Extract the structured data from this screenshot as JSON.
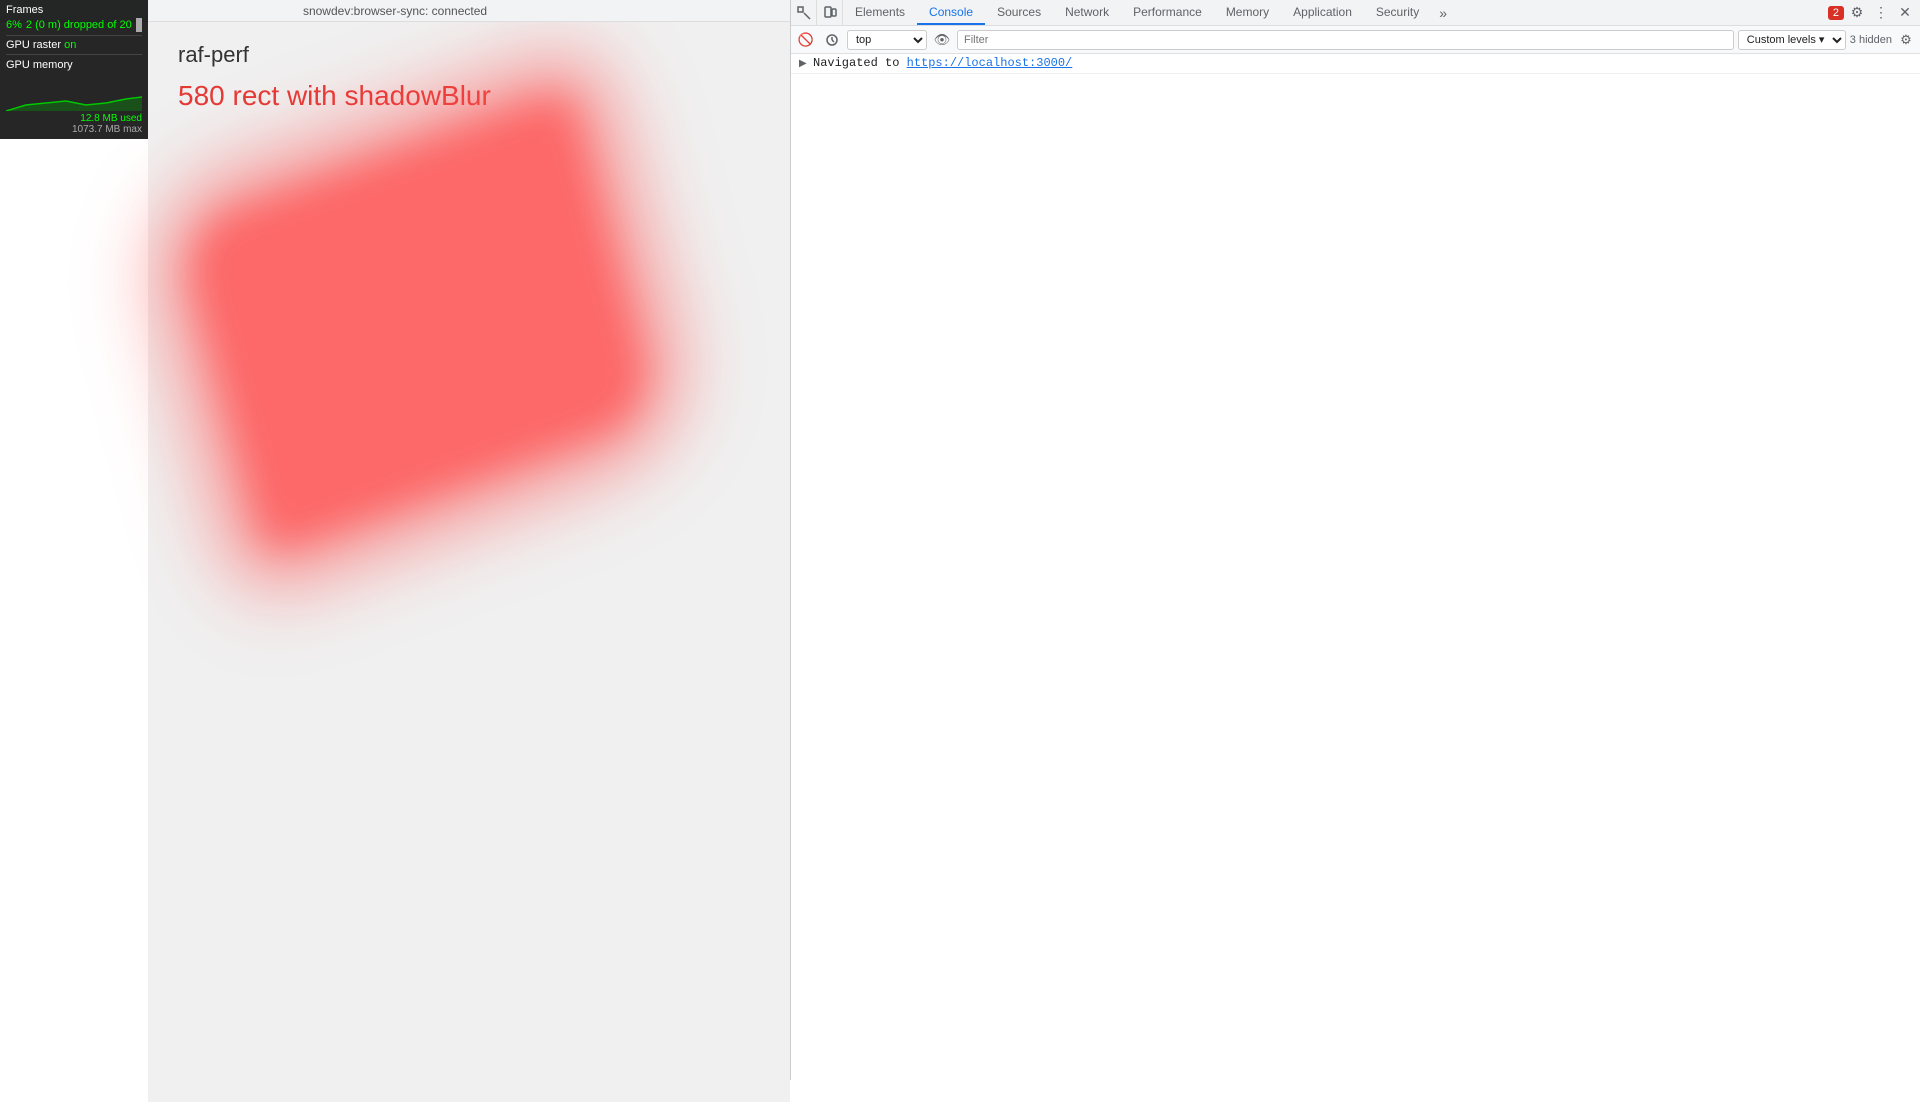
{
  "statusBar": {
    "message": "snowdev:browser-sync: connected"
  },
  "gpuOverlay": {
    "framesLabel": "Frames",
    "framesPercent": "6%",
    "framesDropped": "2 (0 m) dropped of 20",
    "gpuRasterLabel": "GPU raster",
    "gpuRasterStatus": "on",
    "gpuMemLabel": "GPU memory",
    "gpuMemUsed": "12.8 MB used",
    "gpuMemMax": "1073.7 MB max"
  },
  "mainContent": {
    "title": "raf-perf",
    "subtitle": "580 rect with shadowBlur"
  },
  "devtools": {
    "tabs": [
      {
        "label": "Elements",
        "active": false
      },
      {
        "label": "Console",
        "active": true
      },
      {
        "label": "Sources",
        "active": false
      },
      {
        "label": "Network",
        "active": false
      },
      {
        "label": "Performance",
        "active": false
      },
      {
        "label": "Memory",
        "active": false
      },
      {
        "label": "Application",
        "active": false
      },
      {
        "label": "Security",
        "active": false
      }
    ],
    "moreLabel": "»",
    "errorBadge": "2",
    "consoleToolbar": {
      "contextSelect": "top",
      "filterPlaceholder": "Filter",
      "customLevels": "Custom levels ▾",
      "hiddenCount": "3 hidden"
    },
    "consoleLog": {
      "navigatedText": "Navigated to",
      "navigatedUrl": "https://localhost:3000/"
    }
  }
}
